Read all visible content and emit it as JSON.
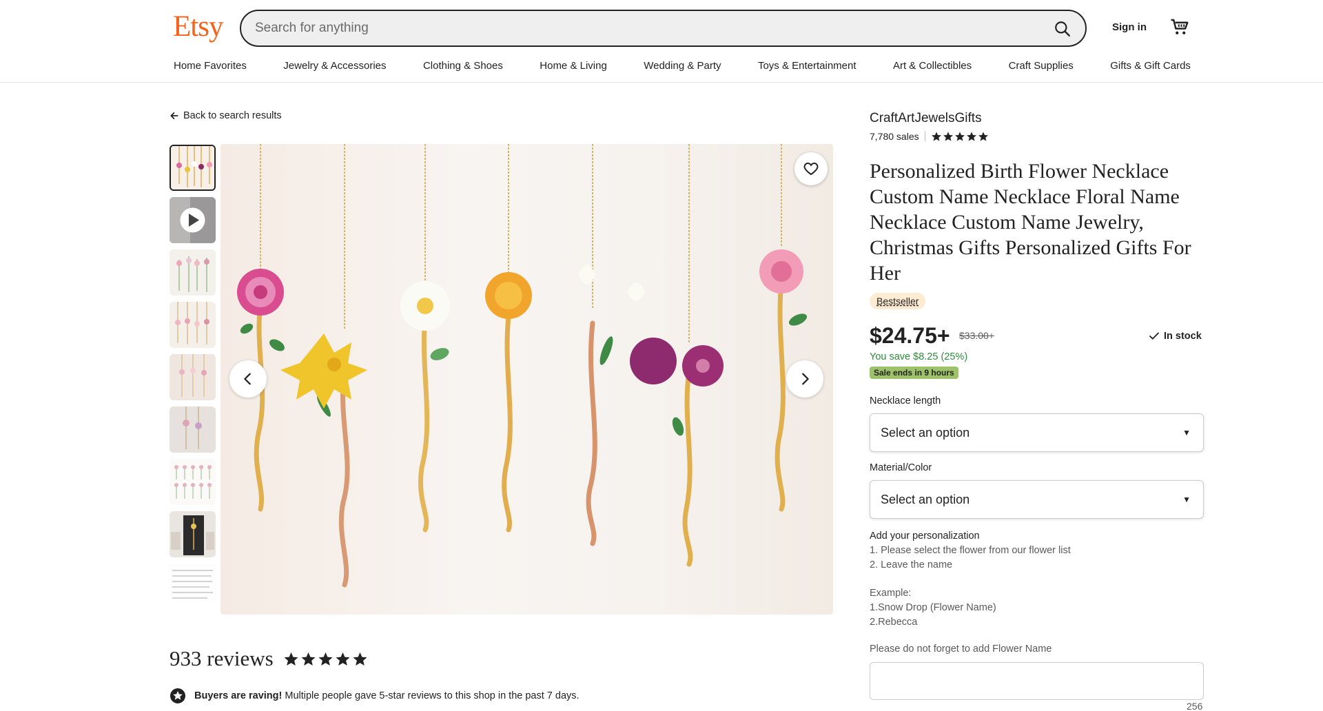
{
  "header": {
    "logo": "Etsy",
    "search_placeholder": "Search for anything",
    "sign_in": "Sign in",
    "categories": [
      "Home Favorites",
      "Jewelry & Accessories",
      "Clothing & Shoes",
      "Home & Living",
      "Wedding & Party",
      "Toys & Entertainment",
      "Art & Collectibles",
      "Craft Supplies",
      "Gifts & Gift Cards"
    ]
  },
  "nav": {
    "back": "Back to search results"
  },
  "shop": {
    "name": "CraftArtJewelsGifts",
    "sales": "7,780 sales",
    "rating_stars": 5
  },
  "product": {
    "title": "Personalized Birth Flower Necklace Custom Name Necklace Floral Name Necklace Custom Name Jewelry, Christmas Gifts Personalized Gifts For Her",
    "badge": "Bestseller",
    "price": "$24.75+",
    "original_price": "$33.00+",
    "stock": "In stock",
    "savings": "You save $8.25 (25%)",
    "sale": "Sale ends in 9 hours"
  },
  "options": {
    "length_label": "Necklace length",
    "length_value": "Select an option",
    "material_label": "Material/Color",
    "material_value": "Select an option"
  },
  "personalization": {
    "heading": "Add your personalization",
    "line1": "1. Please select the flower from our flower list",
    "line2": "2. Leave the name",
    "example_head": "Example:",
    "example1": "1.Snow Drop (Flower Name)",
    "example2": "2.Rebecca",
    "note": "Please do not forget to add Flower Name",
    "counter": "256"
  },
  "reviews": {
    "title": "933 reviews",
    "raving_bold": "Buyers are raving!",
    "raving_text": "Multiple people gave 5-star reviews to this shop in the past 7 days."
  },
  "colors": {
    "brand": "#F1641E",
    "savings": "#2f8a3b",
    "sale_badge": "#9ec269",
    "bestseller_badge": "#fdebd2"
  }
}
